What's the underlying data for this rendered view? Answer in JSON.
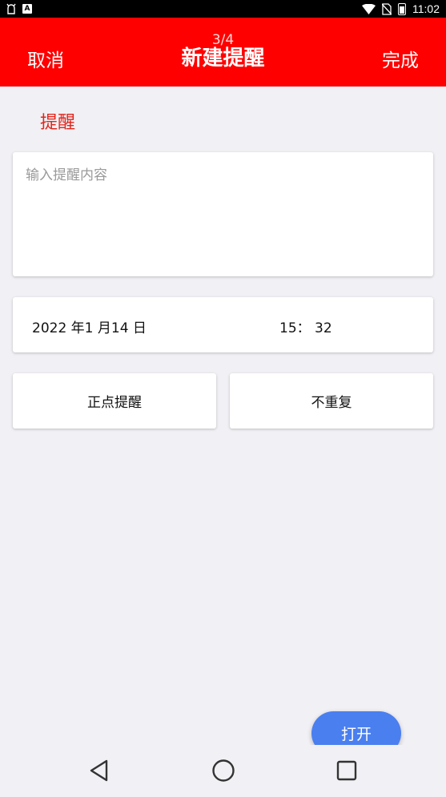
{
  "status_bar": {
    "time": "11:02",
    "left_icons": [
      "notification-icon",
      "app-a-icon"
    ],
    "right_icons": [
      "wifi-icon",
      "no-sim-icon",
      "battery-icon"
    ]
  },
  "app_bar": {
    "cancel_label": "取消",
    "title": "新建提醒",
    "ghost_text": "3/4",
    "done_label": "完成",
    "color": "#fe0000"
  },
  "section": {
    "label": "提醒"
  },
  "content_input": {
    "placeholder": "输入提醒内容",
    "value": ""
  },
  "datetime": {
    "date": "2022 年1 月14 日",
    "time": "15： 32"
  },
  "options": {
    "remind_type": "正点提醒",
    "repeat": "不重复"
  },
  "fab": {
    "label": "打开",
    "color": "#4a7ff0"
  },
  "nav_bar": {
    "icons": [
      "back-icon",
      "home-icon",
      "recents-icon"
    ]
  }
}
